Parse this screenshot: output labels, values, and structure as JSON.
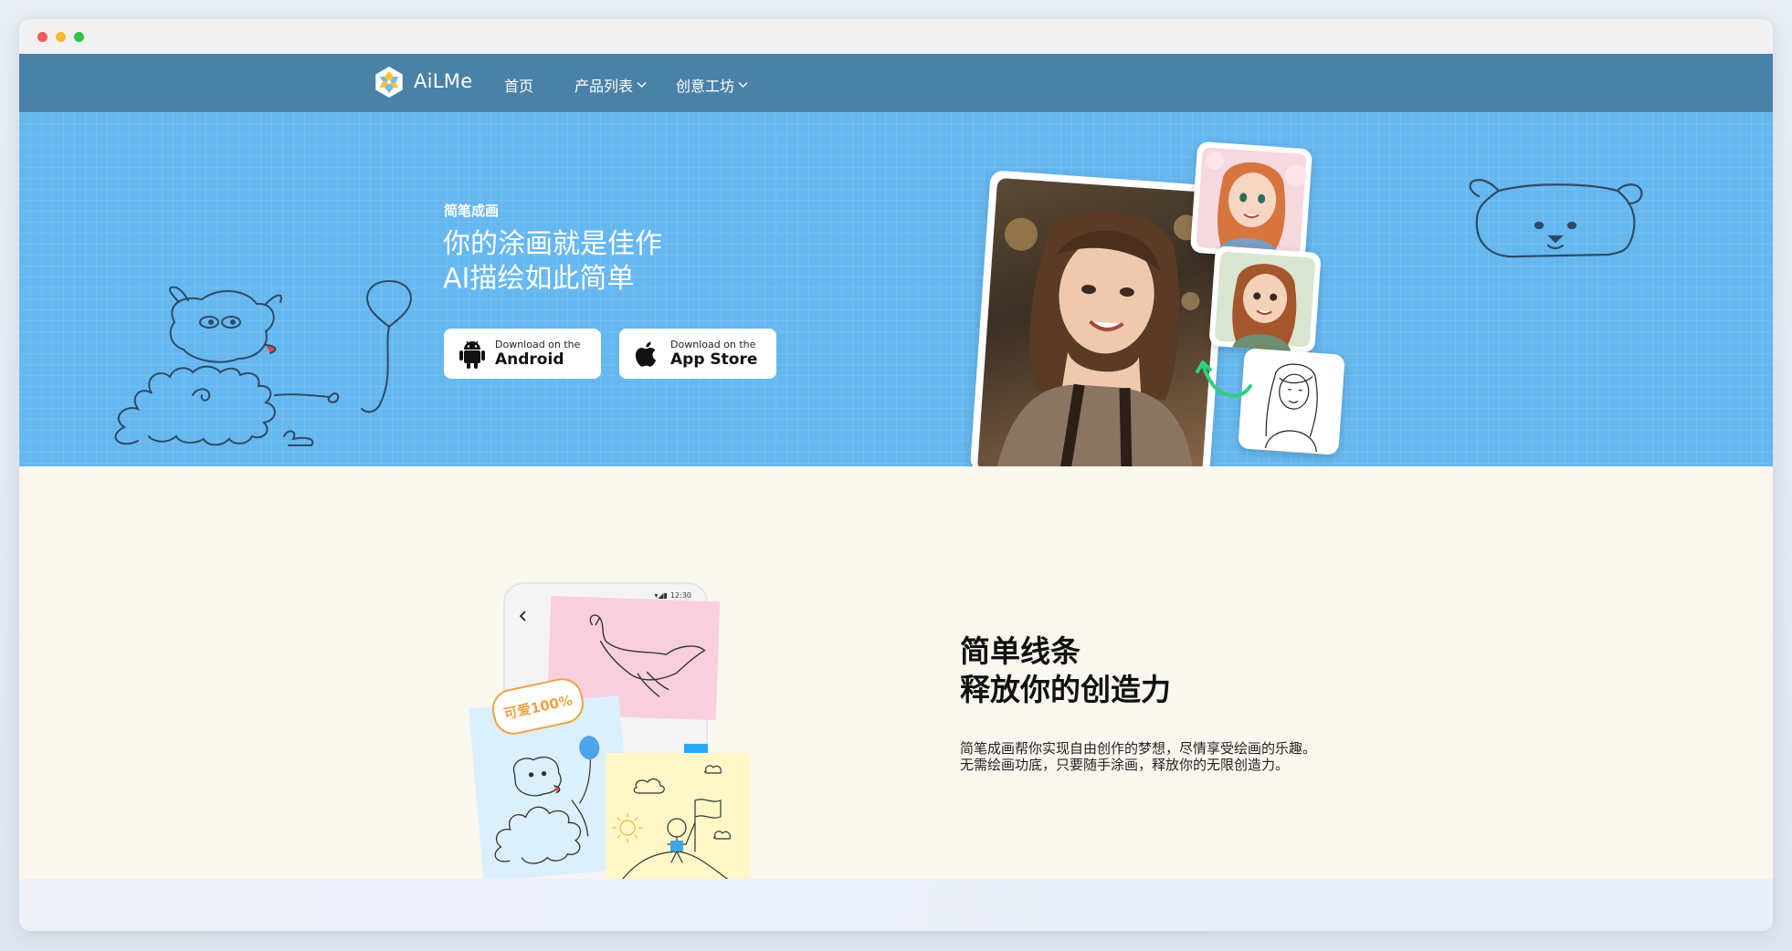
{
  "window": {
    "controls": [
      "close",
      "minimize",
      "maximize"
    ]
  },
  "nav": {
    "brand": "AiLMe",
    "items": [
      {
        "label": "首页",
        "has_dropdown": false
      },
      {
        "label": "产品列表",
        "has_dropdown": true
      },
      {
        "label": "创意工坊",
        "has_dropdown": true
      }
    ]
  },
  "hero": {
    "tag": "简笔成画",
    "title_line1": "你的涂画就是佳作",
    "title_line2": "AI描绘如此简单",
    "buttons": [
      {
        "small": "Download on the",
        "big": "Android",
        "icon": "android-icon"
      },
      {
        "small": "Download on the",
        "big": "App Store",
        "icon": "apple-icon"
      }
    ]
  },
  "section2": {
    "title_line1": "简单线条",
    "title_line2": "释放你的创造力",
    "desc_line1": "简笔成画帮你实现自由创作的梦想，尽情享受绘画的乐趣。",
    "desc_line2": "无需绘画功底，只要随手涂画，释放你的无限创造力。",
    "phone": {
      "status_time": "12:30",
      "sticker_text": "可爱100%"
    }
  },
  "colors": {
    "nav": "#4a82a7",
    "hero": "#65b7ef",
    "section2": "#faf7ef"
  }
}
